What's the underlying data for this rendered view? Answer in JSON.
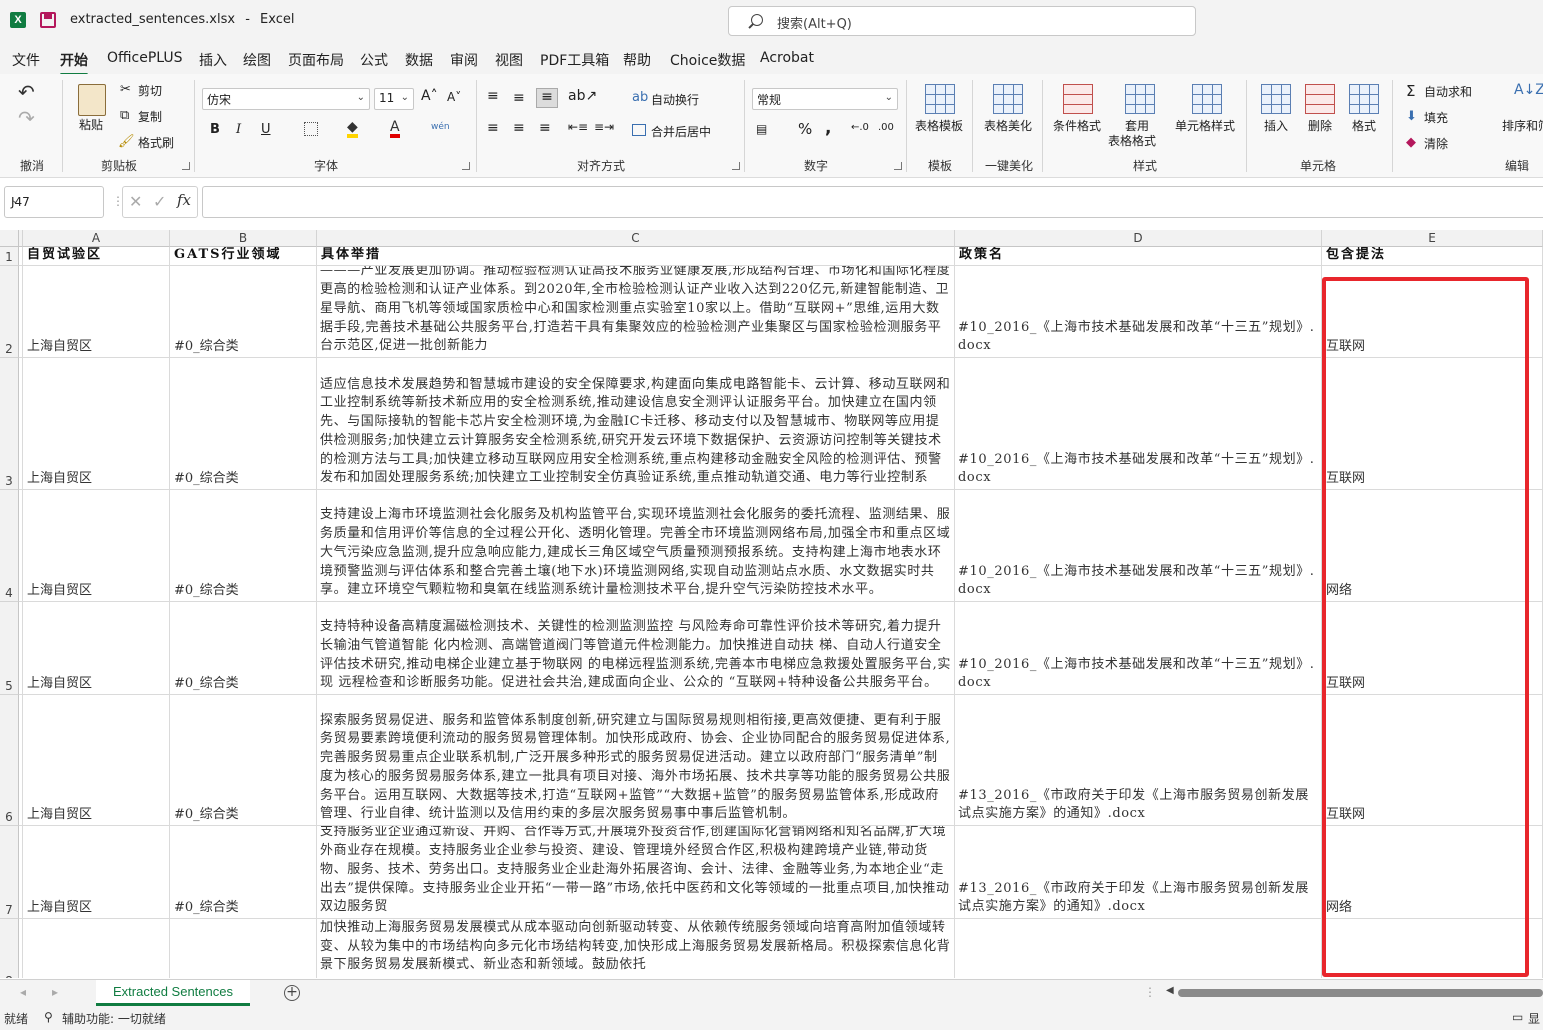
{
  "window": {
    "filename": "extracted_sentences.xlsx",
    "separator": "-",
    "app": "Excel",
    "search_placeholder": "搜索(Alt+Q)"
  },
  "menu": [
    "文件",
    "开始",
    "OfficePLUS",
    "插入",
    "绘图",
    "页面布局",
    "公式",
    "数据",
    "审阅",
    "视图",
    "PDF工具箱",
    "帮助",
    "Choice数据",
    "Acrobat"
  ],
  "menu_active": "开始",
  "ribbon": {
    "undo_group": "撤消",
    "clipboard": {
      "paste": "粘贴",
      "cut": "剪切",
      "copy": "复制",
      "format_painter": "格式刷",
      "label": "剪贴板"
    },
    "font": {
      "name": "仿宋",
      "size": "11",
      "bold": "B",
      "italic": "I",
      "underline": "U",
      "phonetic": "wén",
      "label": "字体"
    },
    "alignment": {
      "wrap": "自动换行",
      "merge": "合并后居中",
      "label": "对齐方式"
    },
    "number": {
      "format": "常规",
      "label": "数字"
    },
    "template": {
      "btn": "表格模板",
      "label": "模板"
    },
    "beautify": {
      "btn": "表格美化",
      "label": "一键美化"
    },
    "styles": {
      "conditional": "条件格式",
      "table_line1": "套用",
      "table_line2": "表格格式",
      "cell_styles": "单元格样式",
      "label": "样式"
    },
    "cells": {
      "insert": "插入",
      "delete": "删除",
      "format": "格式",
      "label": "单元格"
    },
    "editing": {
      "autosum": "自动求和",
      "fill": "填充",
      "clear": "清除",
      "sort": "排序和筛",
      "label": "编辑"
    }
  },
  "formula_bar": {
    "name_box": "J47",
    "formula": ""
  },
  "columns": [
    "A",
    "B",
    "C",
    "D",
    "E"
  ],
  "header_row": {
    "num": "1",
    "A": "自贸试验区",
    "B": "GATS行业领域",
    "C": "具体举措",
    "D": "政策名",
    "E": "包含提法"
  },
  "rows": [
    {
      "num": "2",
      "A": "上海自贸区",
      "B": "#0_综合类",
      "C": "———产业发展更加协调。推动检验检测认证高技术服务业健康发展,形成结构合理、市场化和国际化程度更高的检验检测和认证产业体系。到2020年,全市检验检测认证产业收入达到220亿元,新建智能制造、卫星导航、商用飞机等领域国家质检中心和国家检测重点实验室10家以上。借助“互联网+”思维,运用大数据手段,完善技术基础公共服务平台,打造若干具有集聚效应的检验检测产业集聚区与国家检验检测服务平台示范区,促进一批创新能力",
      "D": "#10_2016_《上海市技术基础发展和改革“十三五”规划》.docx",
      "E": "互联网"
    },
    {
      "num": "3",
      "A": "上海自贸区",
      "B": "#0_综合类",
      "C": "适应信息技术发展趋势和智慧城市建设的安全保障要求,构建面向集成电路智能卡、云计算、移动互联网和工业控制系统等新技术新应用的安全检测系统,推动建设信息安全测评认证服务平台。加快建立在国内领先、与国际接轨的智能卡芯片安全检测环境,为金融IC卡迁移、移动支付以及智慧城市、物联网等应用提供检测服务;加快建立云计算服务安全检测系统,研究开发云环境下数据保护、云资源访问控制等关键技术的检测方法与工具;加快建立移动互联网应用安全检测系统,重点构建移动金融安全风险的检测评估、预警发布和加固处理服务系统;加快建立工业控制安全仿真验证系统,重点推动轨道交通、电力等行业控制系",
      "D": "#10_2016_《上海市技术基础发展和改革“十三五”规划》.docx",
      "E": "互联网"
    },
    {
      "num": "4",
      "A": "上海自贸区",
      "B": "#0_综合类",
      "C": "支持建设上海市环境监测社会化服务及机构监管平台,实现环境监测社会化服务的委托流程、监测结果、服务质量和信用评价等信息的全过程公开化、透明化管理。完善全市环境监测网络布局,加强全市和重点区域大气污染应急监测,提升应急响应能力,建成长三角区域空气质量预测预报系统。支持构建上海市地表水环境预警监测与评估体系和整合完善土壤(地下水)环境监测网络,实现自动监测站点水质、水文数据实时共享。建立环境空气颗粒物和臭氧在线监测系统计量检测技术平台,提升空气污染防控技术水平。",
      "D": "#10_2016_《上海市技术基础发展和改革“十三五”规划》.docx",
      "E": "网络"
    },
    {
      "num": "5",
      "A": "上海自贸区",
      "B": "#0_综合类",
      "C": "支持特种设备高精度漏磁检测技术、关键性的检测监测监控 与风险寿命可靠性评价技术等研究,着力提升长输油气管道智能 化内检测、高端管道阀门等管道元件检测能力。加快推进自动扶 梯、自动人行道安全评估技术研究,推动电梯企业建立基于物联网 的电梯远程监测系统,完善本市电梯应急救援处置服务平台,实现 远程检查和诊断服务功能。促进社会共治,建成面向企业、公众的 “互联网+特种设备公共服务平台。",
      "D": "#10_2016_《上海市技术基础发展和改革“十三五”规划》.docx",
      "E": "互联网"
    },
    {
      "num": "6",
      "A": "上海自贸区",
      "B": "#0_综合类",
      "C": "探索服务贸易促进、服务和监管体系制度创新,研究建立与国际贸易规则相衔接,更高效便捷、更有利于服务贸易要素跨境便利流动的服务贸易管理体制。加快形成政府、协会、企业协同配合的服务贸易促进体系,完善服务贸易重点企业联系机制,广泛开展多种形式的服务贸易促进活动。建立以政府部门“服务清单”制度为核心的服务贸易服务体系,建立一批具有项目对接、海外市场拓展、技术共享等功能的服务贸易公共服务平台。运用互联网、大数据等技术,打造“互联网+监管”“大数据+监管”的服务贸易监管体系,形成政府管理、行业自律、统计监测以及信用约束的多层次服务贸易事中事后监管机制。",
      "D": "#13_2016_《市政府关于印发《上海市服务贸易创新发展试点实施方案》的通知》.docx",
      "E": "互联网"
    },
    {
      "num": "7",
      "A": "上海自贸区",
      "B": "#0_综合类",
      "C": "支持服务业企业通过新设、并购、合作等方式,开展境外投资合作,创建国际化营销网络和知名品牌,扩大境外商业存在规模。支持服务业企业参与投资、建设、管理境外经贸合作区,积极构建跨境产业链,带动货物、服务、技术、劳务出口。支持服务业企业赴海外拓展咨询、会计、法律、金融等业务,为本地企业“走出去”提供保障。支持服务业企业开拓“一带一路”市场,依托中医药和文化等领域的一批重点项目,加快推动双边服务贸",
      "D": "#13_2016_《市政府关于印发《上海市服务贸易创新发展试点实施方案》的通知》.docx",
      "E": "网络"
    },
    {
      "num": "8",
      "A": "",
      "B": "",
      "C": "加快推动上海服务贸易发展模式从成本驱动向创新驱动转变、从依赖传统服务领域向培育高附加值领域转变、从较为集中的市场结构向多元化市场结构转变,加快形成上海服务贸易发展新格局。积极探索信息化背景下服务贸易发展新模式、新业态和新领域。鼓励依托",
      "D": "",
      "E": ""
    }
  ],
  "sheet_tabs": [
    "Extracted Sentences"
  ],
  "status": {
    "ready": "就绪",
    "accessibility": "辅助功能: 一切就绪",
    "right": "显"
  }
}
